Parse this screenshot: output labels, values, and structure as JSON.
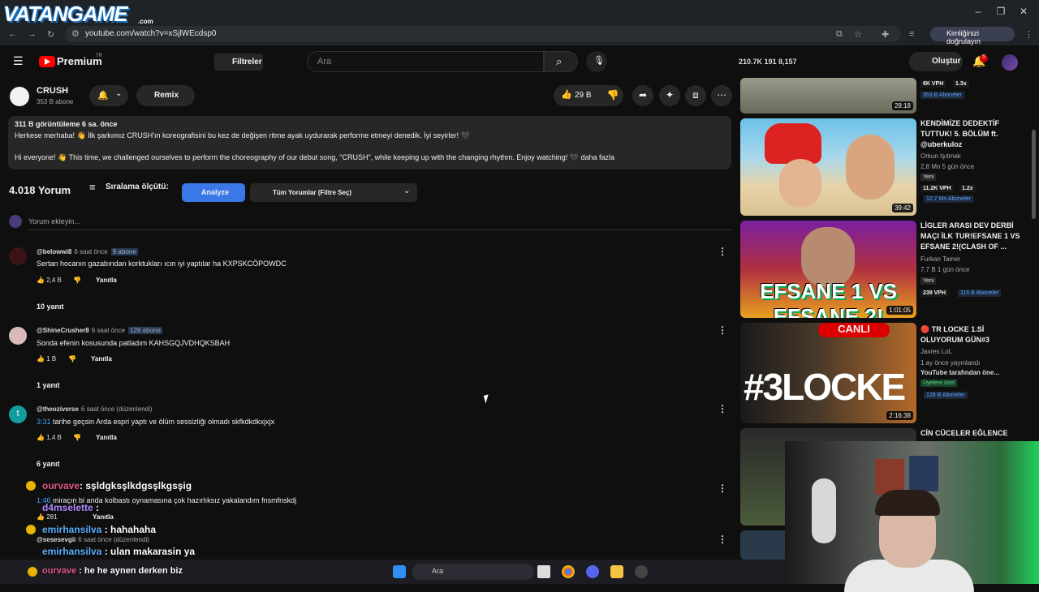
{
  "browser": {
    "logo_text": "VATANGAME",
    "logo_sub": ".com",
    "url": "youtube.com/watch?v=xSjlWEcdsp0",
    "verify_label": "Kimliğinizi doğrulayın"
  },
  "yt_header": {
    "brand": "Premium",
    "region": "TR",
    "filter_label": "Filtreler",
    "search_placeholder": "Ara",
    "stats": "210.7K  191  8,157",
    "create_label": "Oluştur",
    "notif_count": "5"
  },
  "channel": {
    "name": "CRUSH",
    "subs": "353 B abone",
    "remix_label": "Remix",
    "likes": "29 B"
  },
  "description": {
    "meta": "311 B görüntüleme  6 sa. önce",
    "line1": "Herkese merhaba! 👋 İlk şarkımız CRUSH'ın koreografisini bu kez de değişen ritme ayak uydurarak performe etmeyi denedik. İyi seyirler! 🖤",
    "line2": "Hi everyone! 👋 This time, we challenged ourselves to perform the choreography of our debut song, \"CRUSH\", while keeping up with the changing rhythm. Enjoy watching! 🖤  daha fazla"
  },
  "comments_header": {
    "count": "4.018 Yorum",
    "sort_label": "Sıralama ölçütü:",
    "analyze_label": "Analyze",
    "filter_label": "Tüm Yorumlar (Filtre Seç)",
    "add_placeholder": "Yorum ekleyin..."
  },
  "comments": [
    {
      "user": "@belowwi8",
      "time": "6 saat önce",
      "badge": "9 abone",
      "text": "Sertan hocanın gazabından korktukları ıcın iyi yaptılar ha KXPSKCÖPOWDC",
      "likes": "2,4 B",
      "reply": "Yanıtla",
      "replies": "10 yanıt"
    },
    {
      "user": "@ShineCrusher8",
      "time": "6 saat önce",
      "badge": "126 abone",
      "text": "Sonda efenin kosusunda patladım KAHSGQJVDHQKSBAH",
      "likes": "1 B",
      "reply": "Yanıtla",
      "replies": "1 yanıt"
    },
    {
      "user": "@theoziverse",
      "time": "6 saat önce (düzenlendi)",
      "badge": "",
      "ts": "3:31",
      "text": "tarihe geçsin Arda espri yaptı ve ölüm sessizliği olmadı skfkdkdkxjxjx",
      "likes": "1,4 B",
      "reply": "Yanıtla",
      "replies": "6 yanıt"
    },
    {
      "user": "",
      "time": "",
      "badge": "",
      "ts": "1:46",
      "text": "miraçın bi anda kolbastı oynamasına çok hazırlıksız yakalandım fnsmfnskdj",
      "likes": "281",
      "reply": "Yanıtla",
      "replies": ""
    },
    {
      "user": "@sesesevgii",
      "time": "6 saat önce (düzenlendi)",
      "badge": "",
      "text": "",
      "likes": "",
      "reply": "",
      "replies": ""
    }
  ],
  "videos": [
    {
      "title": "",
      "channel": "",
      "meta": "",
      "tag": "",
      "vph": "6K VPH",
      "ratio": "1.3x",
      "abone": "353 B Aboneler",
      "duration": "28:18"
    },
    {
      "title": "KENDİMİZE DEDEKTİF TUTTUK! 5. BÖLÜM ft. @uberkuloz",
      "channel": "Orkun Işıtmak",
      "meta": "2,8 Mn  5 gün önce",
      "tag": "Yeni",
      "vph": "11.2K VPH",
      "ratio": "1.2x",
      "abone": "12.7 Mn Aboneler",
      "duration": "39:42"
    },
    {
      "title": "LİGLER ARASI DEV DERBİ MAÇI İLK TUR!EFSANE 1 VS EFSANE 2!(CLASH OF ...",
      "channel": "Furkan Tamer",
      "meta": "7,7 B  1 gün önce",
      "tag": "Yeni",
      "vph": "239 VPH",
      "ratio": "",
      "abone": "116 B Aboneler",
      "duration": "1:01:05"
    },
    {
      "title": "🔴 TR LOCKE 1.Sİ OLUYORUM GÜN#3",
      "channel": "Jaxres LoL",
      "meta": "1 ay önce yayınlandı",
      "extra": "YouTube tarafından öne...",
      "tag": "Üyelere özel",
      "vph": "",
      "ratio": "",
      "abone": "128 B Aboneler",
      "duration": "2:16:38"
    },
    {
      "title": "CİN CÜCELER EĞLENCE",
      "channel": "",
      "meta": "",
      "tag": "",
      "vph": "",
      "ratio": "",
      "abone": "",
      "duration": ""
    }
  ],
  "chat": [
    {
      "user": "ourvave",
      "msg": ": sşldgksşlkdgsşlkgsşig",
      "color": "#e05a8a"
    },
    {
      "user": "d4mselette",
      "msg": ":",
      "color": "#b28cff"
    },
    {
      "user": "emirhansilva",
      "msg": ": hahahaha",
      "color": "#5ab0ff"
    },
    {
      "user": "emirhansilva",
      "msg": ": ulan makarasin ya",
      "color": "#5ab0ff"
    },
    {
      "user": "ourvave",
      "msg": ": he he aynen derken biz",
      "color": "#e05a8a"
    }
  ],
  "taskbar": {
    "search_label": "Ara"
  },
  "colors": {
    "accent_red": "#ff0000",
    "link_blue": "#3ea6ff",
    "analyze_blue": "#3b78e7"
  }
}
